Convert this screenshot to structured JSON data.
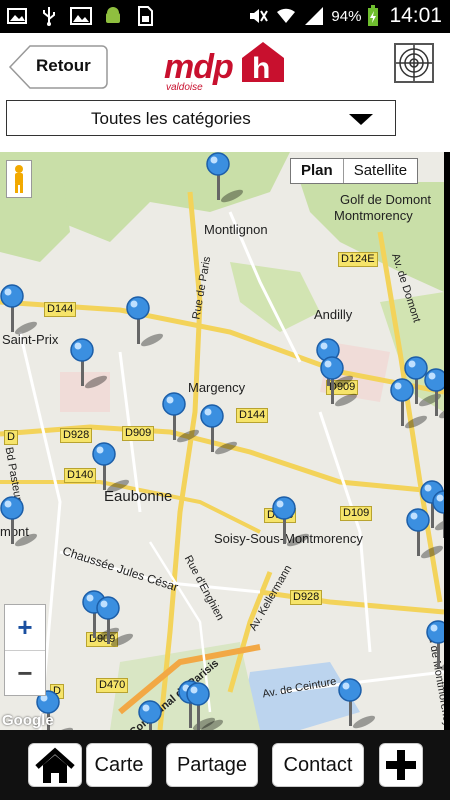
{
  "status_bar": {
    "battery": "94%",
    "time": "14:01",
    "icons": [
      "gallery-notification-icon",
      "usb-icon",
      "image-icon",
      "android-icon",
      "sim-icon",
      "mute-icon",
      "wifi-icon",
      "signal-icon",
      "battery-charging-icon"
    ]
  },
  "header": {
    "back_label": "Retour",
    "logo_text": "mdp",
    "logo_sub": "valdoise",
    "logo_mark": "h",
    "locate_icon": "crosshair-icon"
  },
  "category": {
    "selected": "Toutes les catégories"
  },
  "map": {
    "type_buttons": [
      "Plan",
      "Satellite"
    ],
    "active_type": "Plan",
    "attribution": "Google",
    "zoom_in": "+",
    "zoom_out": "−",
    "labels": {
      "montlignon": "Montlignon",
      "golf": "Golf de Domont",
      "montmorency": "Montmorency",
      "saint_prix": "Saint-Prix",
      "margency": "Margency",
      "andilly": "Andilly",
      "eaubonne": "Eaubonne",
      "soisy": "Soisy-Sous-Montmorency",
      "mont": "mont",
      "chaussee": "Chaussée Jules César",
      "rue_paris": "Rue de Paris",
      "av_domont": "Av. de Domont",
      "bd_pasteur": "Bd Pasteur",
      "av_kellermann": "Av. Kellermann",
      "rue_enghien": "Rue d'Enghien",
      "av_ceinture": "Av. de Ceinture",
      "bd_montmorency": "Bd de Montmorency",
      "parisis": "Communal du Parisis"
    },
    "road_signs": {
      "d144_a": "D144",
      "d144_b": "D144",
      "d124e": "D124E",
      "d928_a": "D928",
      "d909_a": "D909",
      "d140": "D140",
      "d909_b": "D909",
      "d109": "D109",
      "d928_b": "D928",
      "d470": "D470",
      "d_a": "D",
      "d_b": "D",
      "d909_c": "D909",
      "d928_c": "D928"
    }
  },
  "bottom": {
    "home_icon": "home-icon",
    "carte": "Carte",
    "partage": "Partage",
    "contact": "Contact",
    "add_icon": "plus-icon"
  }
}
